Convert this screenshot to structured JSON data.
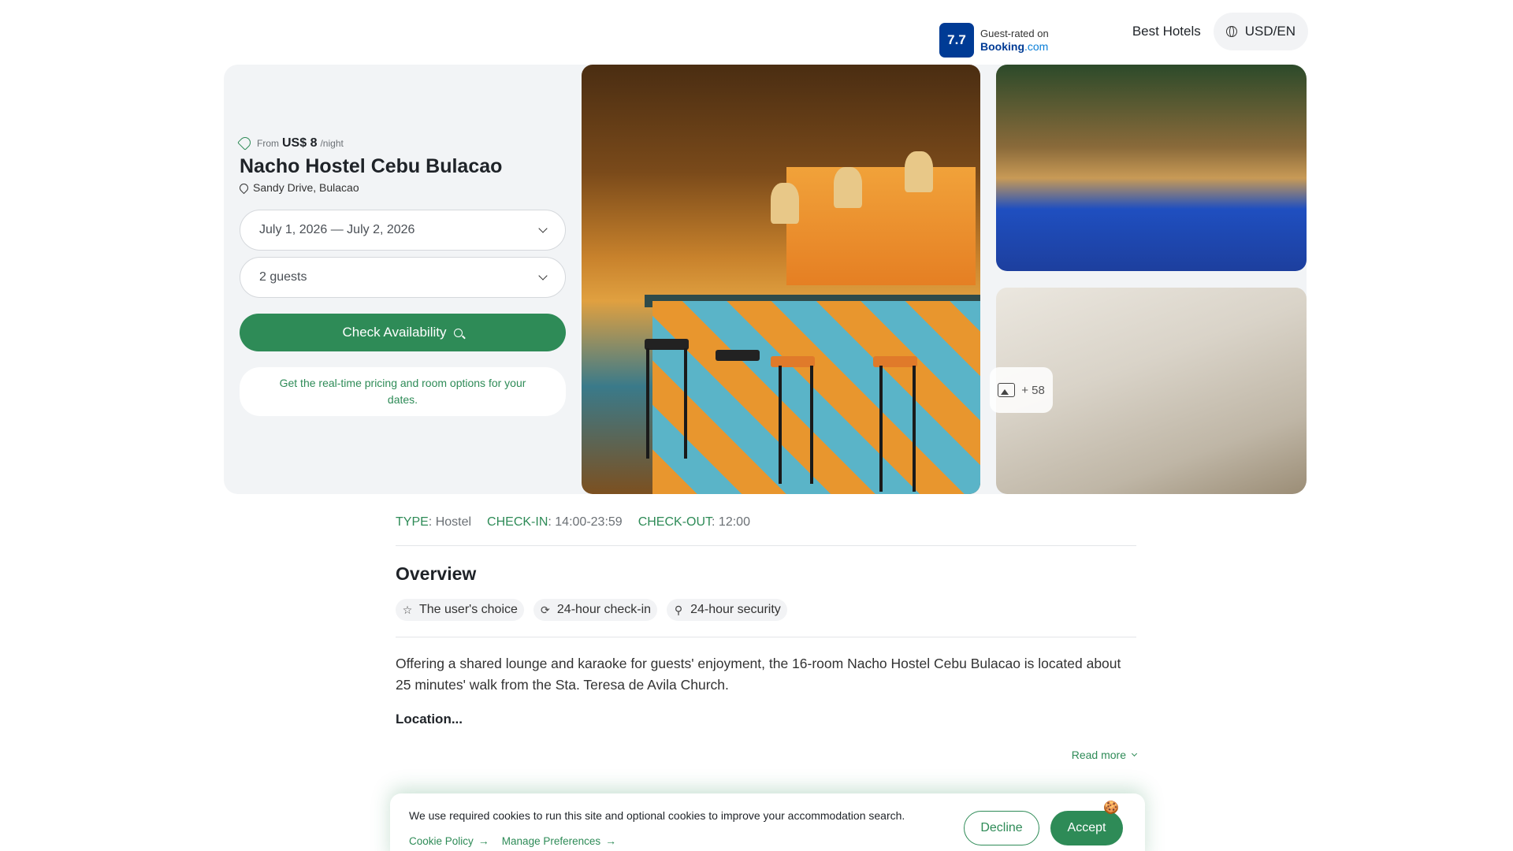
{
  "nav": {
    "best_hotels": "Best Hotels",
    "currency": "USD/EN"
  },
  "hotel": {
    "from_label": "From",
    "price": "US$ 8",
    "per_night": "/night",
    "name": "Nacho Hostel Cebu Bulacao",
    "address": "Sandy Drive, Bulacao"
  },
  "booking": {
    "dates": "July 1, 2026 — July 2, 2026",
    "guests": "2 guests",
    "check_button": "Check Availability",
    "hint": "Get the real-time pricing and room options for your dates."
  },
  "rating": {
    "score": "7.7",
    "label": "Guest-rated on",
    "brand_main": "Booking",
    "brand_suffix": ".com"
  },
  "gallery": {
    "more_count": "+ 58"
  },
  "meta": {
    "type_key": "TYPE",
    "type_value": "Hostel",
    "checkin_key": "CHECK-IN",
    "checkin_value": "14:00-23:59",
    "checkout_key": "CHECK-OUT",
    "checkout_value": "12:00"
  },
  "overview": {
    "title": "Overview",
    "chips": [
      {
        "icon": "star-icon",
        "label": "The user's choice"
      },
      {
        "icon": "refresh-icon",
        "label": "24-hour check-in"
      },
      {
        "icon": "person-shield-icon",
        "label": "24-hour security"
      }
    ],
    "description": "Offering a shared lounge and karaoke for guests' enjoyment, the 16-room Nacho Hostel Cebu Bulacao is located about 25 minutes' walk from the Sta. Teresa de Avila Church.",
    "location_heading": "Location...",
    "read_more": "Read more"
  },
  "cookie": {
    "text": "We use required cookies to run this site and optional cookies to improve your accommodation search.",
    "policy_link": "Cookie Policy",
    "preferences_link": "Manage Preferences",
    "decline": "Decline",
    "accept": "Accept"
  },
  "colors": {
    "brand_green": "#2e8b57",
    "booking_blue": "#003b95"
  }
}
